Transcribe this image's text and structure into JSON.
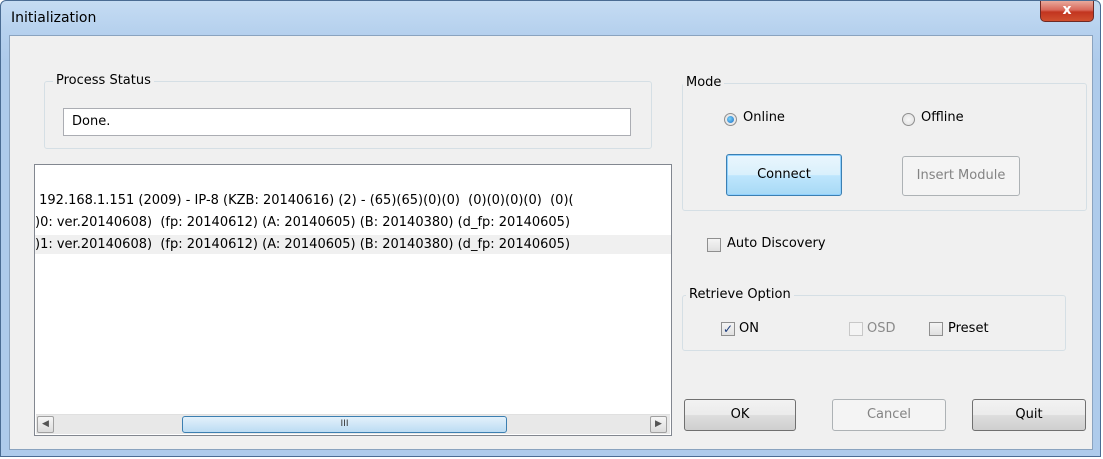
{
  "window": {
    "title": "Initialization",
    "close_glyph": "x"
  },
  "process_status": {
    "label": "Process Status",
    "value": "Done."
  },
  "log": {
    "lines": [
      " 192.168.1.151 (2009) - IP-8 (KZB: 20140616) (2) - (65)(65)(0)(0)  (0)(0)(0)(0)  (0)(",
      ")0: ver.20140608)  (fp: 20140612) (A: 20140605) (B: 20140380) (d_fp: 20140605)",
      ")1: ver.20140608)  (fp: 20140612) (A: 20140605) (B: 20140380) (d_fp: 20140605)"
    ],
    "scroll_left": "◀",
    "scroll_right": "▶",
    "thumb_grip": "III"
  },
  "mode": {
    "label": "Mode",
    "online_label": "Online",
    "offline_label": "Offline",
    "selected": "Online",
    "connect_label": "Connect",
    "insert_module_label": "Insert Module"
  },
  "auto_discovery": {
    "label": "Auto Discovery",
    "checked": false
  },
  "retrieve_option": {
    "label": "Retrieve Option",
    "on_label": "ON",
    "on_checked": true,
    "osd_label": "OSD",
    "osd_checked": false,
    "preset_label": "Preset",
    "preset_checked": false,
    "check_glyph": "✓"
  },
  "footer": {
    "ok_label": "OK",
    "cancel_label": "Cancel",
    "quit_label": "Quit"
  }
}
